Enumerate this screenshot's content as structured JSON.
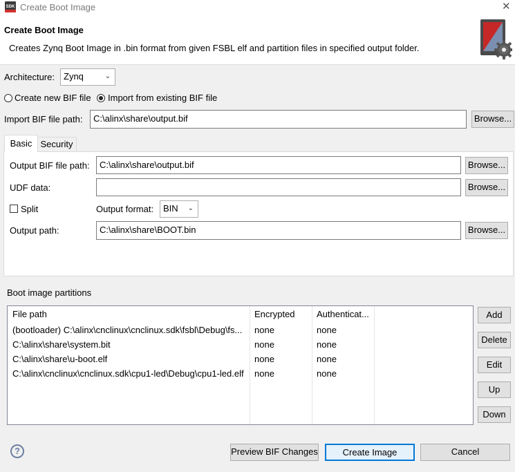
{
  "window": {
    "title": "Create Boot Image",
    "app_icon_text": "SDK"
  },
  "header": {
    "title": "Create Boot Image",
    "description": "Creates Zynq Boot Image in .bin format from given FSBL elf and partition files in specified output folder."
  },
  "architecture": {
    "label": "Architecture:",
    "value": "Zynq"
  },
  "bif_mode": {
    "create_new_label": "Create new BIF file",
    "import_existing_label": "Import from existing BIF file",
    "selected": "import"
  },
  "import_bif": {
    "label": "Import BIF file path:",
    "value": "C:\\alinx\\share\\output.bif",
    "browse": "Browse..."
  },
  "tabs": [
    {
      "label": "Basic"
    },
    {
      "label": "Security"
    }
  ],
  "basic": {
    "output_bif": {
      "label": "Output BIF file path:",
      "value": "C:\\alinx\\share\\output.bif",
      "browse": "Browse..."
    },
    "udf": {
      "label": "UDF data:",
      "value": "",
      "browse": "Browse..."
    },
    "split": {
      "label": "Split",
      "checked": false
    },
    "output_format": {
      "label": "Output format:",
      "value": "BIN"
    },
    "output_path": {
      "label": "Output path:",
      "value": "C:\\alinx\\share\\BOOT.bin",
      "browse": "Browse..."
    }
  },
  "partitions": {
    "section_label": "Boot image partitions",
    "columns": [
      "File path",
      "Encrypted",
      "Authenticat..."
    ],
    "rows": [
      {
        "path": "(bootloader) C:\\alinx\\cnclinux\\cnclinux.sdk\\fsbl\\Debug\\fs...",
        "encrypted": "none",
        "auth": "none"
      },
      {
        "path": "C:\\alinx\\share\\system.bit",
        "encrypted": "none",
        "auth": "none"
      },
      {
        "path": "C:\\alinx\\share\\u-boot.elf",
        "encrypted": "none",
        "auth": "none"
      },
      {
        "path": "C:\\alinx\\cnclinux\\cnclinux.sdk\\cpu1-led\\Debug\\cpu1-led.elf",
        "encrypted": "none",
        "auth": "none"
      }
    ],
    "buttons": {
      "add": "Add",
      "delete": "Delete",
      "edit": "Edit",
      "up": "Up",
      "down": "Down"
    }
  },
  "footer": {
    "help": "?",
    "preview": "Preview BIF Changes",
    "create": "Create Image",
    "cancel": "Cancel"
  },
  "colors": {
    "default_button_border": "#0078d7",
    "dialog_bg": "#f0f0f0",
    "accent_red": "#d32f2f"
  }
}
